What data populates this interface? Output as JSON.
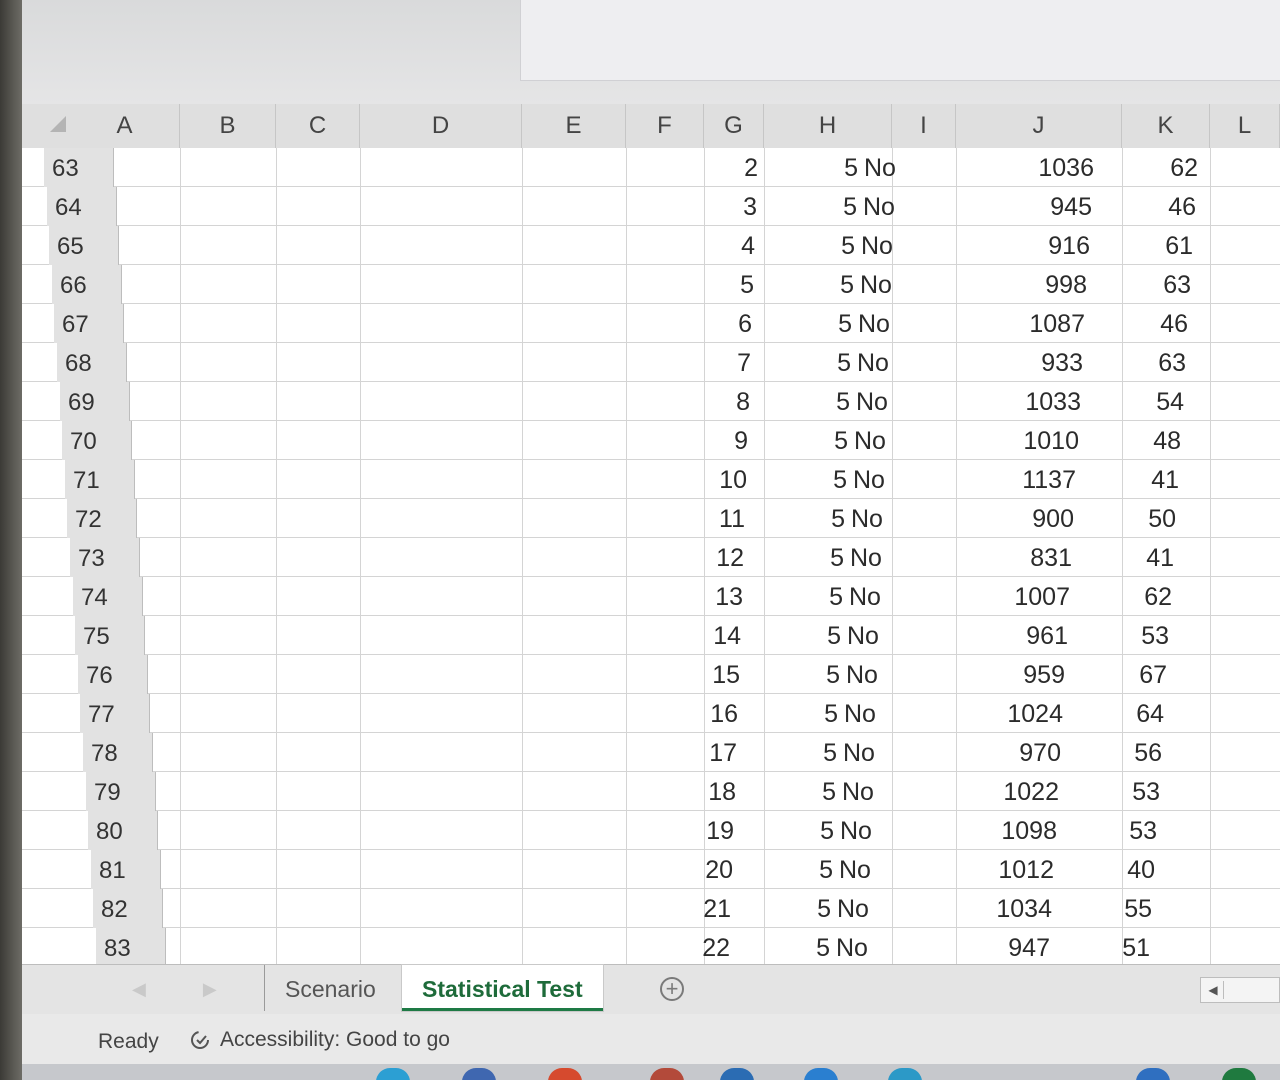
{
  "columns": [
    "A",
    "B",
    "C",
    "D",
    "E",
    "F",
    "G",
    "H",
    "I",
    "J",
    "K",
    "L"
  ],
  "rows": [
    {
      "num": "63",
      "g": "2",
      "h": "5",
      "i": "No",
      "j": "1036",
      "k": "62"
    },
    {
      "num": "64",
      "g": "3",
      "h": "5",
      "i": "No",
      "j": "945",
      "k": "46"
    },
    {
      "num": "65",
      "g": "4",
      "h": "5",
      "i": "No",
      "j": "916",
      "k": "61"
    },
    {
      "num": "66",
      "g": "5",
      "h": "5",
      "i": "No",
      "j": "998",
      "k": "63"
    },
    {
      "num": "67",
      "g": "6",
      "h": "5",
      "i": "No",
      "j": "1087",
      "k": "46"
    },
    {
      "num": "68",
      "g": "7",
      "h": "5",
      "i": "No",
      "j": "933",
      "k": "63"
    },
    {
      "num": "69",
      "g": "8",
      "h": "5",
      "i": "No",
      "j": "1033",
      "k": "54"
    },
    {
      "num": "70",
      "g": "9",
      "h": "5",
      "i": "No",
      "j": "1010",
      "k": "48"
    },
    {
      "num": "71",
      "g": "10",
      "h": "5",
      "i": "No",
      "j": "1137",
      "k": "41"
    },
    {
      "num": "72",
      "g": "11",
      "h": "5",
      "i": "No",
      "j": "900",
      "k": "50"
    },
    {
      "num": "73",
      "g": "12",
      "h": "5",
      "i": "No",
      "j": "831",
      "k": "41"
    },
    {
      "num": "74",
      "g": "13",
      "h": "5",
      "i": "No",
      "j": "1007",
      "k": "62"
    },
    {
      "num": "75",
      "g": "14",
      "h": "5",
      "i": "No",
      "j": "961",
      "k": "53"
    },
    {
      "num": "76",
      "g": "15",
      "h": "5",
      "i": "No",
      "j": "959",
      "k": "67"
    },
    {
      "num": "77",
      "g": "16",
      "h": "5",
      "i": "No",
      "j": "1024",
      "k": "64"
    },
    {
      "num": "78",
      "g": "17",
      "h": "5",
      "i": "No",
      "j": "970",
      "k": "56"
    },
    {
      "num": "79",
      "g": "18",
      "h": "5",
      "i": "No",
      "j": "1022",
      "k": "53"
    },
    {
      "num": "80",
      "g": "19",
      "h": "5",
      "i": "No",
      "j": "1098",
      "k": "53"
    },
    {
      "num": "81",
      "g": "20",
      "h": "5",
      "i": "No",
      "j": "1012",
      "k": "40"
    },
    {
      "num": "82",
      "g": "21",
      "h": "5",
      "i": "No",
      "j": "1034",
      "k": "55"
    },
    {
      "num": "83",
      "g": "22",
      "h": "5",
      "i": "No",
      "j": "947",
      "k": "51"
    }
  ],
  "tabs": [
    {
      "label": "Scenario",
      "active": false
    },
    {
      "label": "Statistical Test",
      "active": true
    }
  ],
  "status": {
    "ready": "Ready",
    "accessibility": "Accessibility: Good to go"
  },
  "colors": {
    "active_tab": "#1e6b3a",
    "grid_line": "#d4d4d4"
  }
}
